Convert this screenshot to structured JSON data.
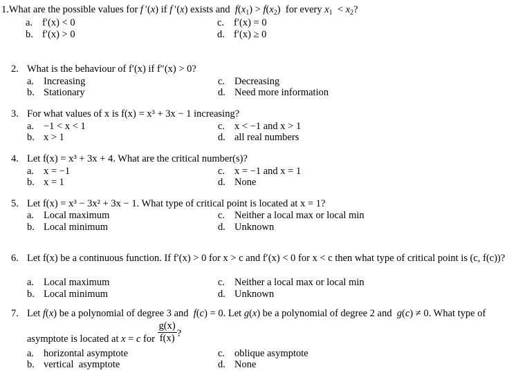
{
  "questions": [
    {
      "number": "1.",
      "stem_html": "What are the possible values for <span class='m'>f</span>&thinsp;′(<span class='m'>x</span>) if <span class='m'>f</span>&thinsp;′(<span class='m'>x</span>) exists and <span class='m'>f</span>(<span class='m'>x</span><sub>1</sub>) &gt; <span class='m'>f</span>(<span class='m'>x</span><sub>2</sub>)  for every <span class='m'>x</span><sub>1</sub> &lt; <span class='m'>x</span><sub>2</sub>?",
      "stem": "What are the possible values for f′(x) if f′(x) exists and f(x1) > f(x2) for every x1 < x2?",
      "options": [
        {
          "letter": "a.",
          "text": "f′(x) < 0"
        },
        {
          "letter": "b.",
          "text": "f′(x) > 0"
        },
        {
          "letter": "c.",
          "text": "f′(x) = 0"
        },
        {
          "letter": "d.",
          "text": "f′(x) ≥ 0"
        }
      ]
    },
    {
      "number": "2.",
      "stem": "What is the behaviour of f′(x) if f″(x) > 0?",
      "options": [
        {
          "letter": "a.",
          "text": "Increasing"
        },
        {
          "letter": "b.",
          "text": "Stationary"
        },
        {
          "letter": "c.",
          "text": "Decreasing"
        },
        {
          "letter": "d.",
          "text": "Need more information"
        }
      ]
    },
    {
      "number": "3.",
      "stem": "For what values of x is f(x) = x³ + 3x − 1 increasing?",
      "options": [
        {
          "letter": "a.",
          "text": "−1 < x < 1"
        },
        {
          "letter": "b.",
          "text": "x > 1"
        },
        {
          "letter": "c.",
          "text": "x < −1 and x > 1"
        },
        {
          "letter": "d.",
          "text": "all real numbers"
        }
      ]
    },
    {
      "number": "4.",
      "stem": "Let f(x) = x³ + 3x + 4. What are the critical number(s)?",
      "options": [
        {
          "letter": "a.",
          "text": "x = −1"
        },
        {
          "letter": "b.",
          "text": "x = 1"
        },
        {
          "letter": "c.",
          "text": "x = −1 and x = 1"
        },
        {
          "letter": "d.",
          "text": "None"
        }
      ]
    },
    {
      "number": "5.",
      "stem": "Let f(x) = x³ − 3x² + 3x − 1. What type of critical point is located at x = 1?",
      "options": [
        {
          "letter": "a.",
          "text": "Local maximum"
        },
        {
          "letter": "b.",
          "text": "Local minimum"
        },
        {
          "letter": "c.",
          "text": "Neither a local max or local min"
        },
        {
          "letter": "d.",
          "text": "Unknown"
        }
      ]
    },
    {
      "number": "6.",
      "stem": "Let f(x) be a continuous function. If f′(x) > 0 for x > c and f′(x) < 0 for x < c then what type of critical point is (c, f(c))?",
      "options": [
        {
          "letter": "a.",
          "text": "Local maximum"
        },
        {
          "letter": "b.",
          "text": "Local minimum"
        },
        {
          "letter": "c.",
          "text": "Neither a local max or local min"
        },
        {
          "letter": "d.",
          "text": "Unknown"
        }
      ]
    },
    {
      "number": "7.",
      "stem": "Let f(x) be a polynomial of degree 3 and f(c) = 0. Let g(x) be a polynomial of degree 2 and g(c) ≠ 0. What type of asymptote is located at x = c for g(x)/f(x)?",
      "fraction": {
        "numerator": "g(x)",
        "denominator": "f(x)"
      },
      "options": [
        {
          "letter": "a.",
          "text": "horizontal asymptote"
        },
        {
          "letter": "b.",
          "text": "vertical  asymptote"
        },
        {
          "letter": "c.",
          "text": "oblique asymptote"
        },
        {
          "letter": "d.",
          "text": "None"
        }
      ]
    }
  ]
}
